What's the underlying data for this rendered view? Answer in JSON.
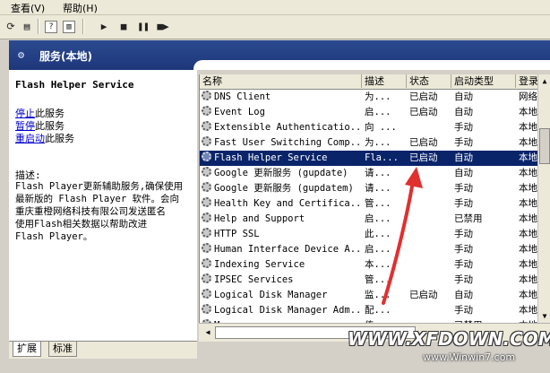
{
  "menu": {
    "view": "查看(V)",
    "help": "帮助(H)"
  },
  "header": {
    "title": "服务(本地)"
  },
  "left": {
    "service_title": "Flash Helper Service",
    "stop_link": "停止",
    "stop_suffix": "此服务",
    "pause_link": "暂停",
    "pause_suffix": "此服务",
    "restart_link": "重启动",
    "restart_suffix": "此服务",
    "desc_label": "描述:",
    "description": "Flash Player更新辅助服务,确保使用\n最新版的 Flash Player 软件。会向\n重庆重橙网络科技有限公司发送匿名\n使用Flash相关数据以帮助改进\nFlash Player。"
  },
  "tabs": {
    "extended": "扩展",
    "standard": "标准"
  },
  "columns": {
    "name": "名称",
    "desc": "描述",
    "status": "状态",
    "startup": "启动类型",
    "logon": "登录"
  },
  "rows": [
    {
      "name": "DNS Client",
      "desc": "为...",
      "status": "已启动",
      "startup": "自动",
      "logon": "网络"
    },
    {
      "name": "Event Log",
      "desc": "启...",
      "status": "已启动",
      "startup": "自动",
      "logon": "本地"
    },
    {
      "name": "Extensible Authenticatio...",
      "desc": "向 ...",
      "status": "",
      "startup": "手动",
      "logon": "本地"
    },
    {
      "name": "Fast User Switching Comp...",
      "desc": "为...",
      "status": "已启动",
      "startup": "手动",
      "logon": "本地"
    },
    {
      "name": "Flash Helper Service",
      "desc": "Fla...",
      "status": "已启动",
      "startup": "自动",
      "logon": "本地"
    },
    {
      "name": "Google 更新服务 (gupdate)",
      "desc": "请...",
      "status": "",
      "startup": "自动",
      "logon": "本地"
    },
    {
      "name": "Google 更新服务 (gupdatem)",
      "desc": "请...",
      "status": "",
      "startup": "手动",
      "logon": "本地"
    },
    {
      "name": "Health Key and Certifica...",
      "desc": "管...",
      "status": "",
      "startup": "手动",
      "logon": "本地"
    },
    {
      "name": "Help and Support",
      "desc": "启...",
      "status": "",
      "startup": "已禁用",
      "logon": "本地"
    },
    {
      "name": "HTTP SSL",
      "desc": "此...",
      "status": "",
      "startup": "手动",
      "logon": "本地"
    },
    {
      "name": "Human Interface Device A...",
      "desc": "启...",
      "status": "",
      "startup": "手动",
      "logon": "本地"
    },
    {
      "name": "Indexing Service",
      "desc": "本...",
      "status": "",
      "startup": "手动",
      "logon": "本地"
    },
    {
      "name": "IPSEC Services",
      "desc": "管...",
      "status": "",
      "startup": "手动",
      "logon": "本地"
    },
    {
      "name": "Logical Disk Manager",
      "desc": "监...",
      "status": "已启动",
      "startup": "自动",
      "logon": "本地"
    },
    {
      "name": "Logical Disk Manager Adm...",
      "desc": "配...",
      "status": "",
      "startup": "手动",
      "logon": "本地"
    },
    {
      "name": "Messenger",
      "desc": "传...",
      "status": "",
      "startup": "已禁用",
      "logon": "本地"
    }
  ],
  "selected_index": 4,
  "watermark": {
    "main": "WWW.XFDOWN.COM",
    "sub": "www.Winwin7.com"
  },
  "colors": {
    "selected": "#0a246a",
    "header": "#1d377a",
    "arrow": "#e03030"
  }
}
